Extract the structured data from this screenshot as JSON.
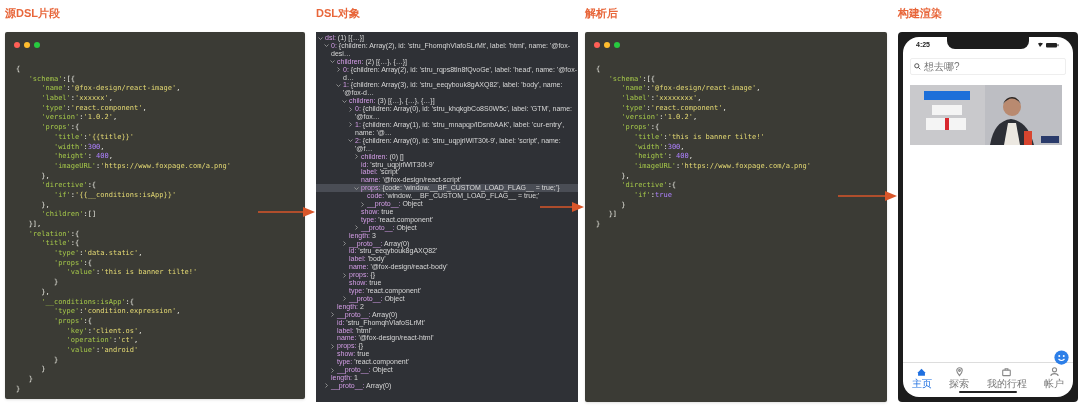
{
  "stages": [
    {
      "kind": "code",
      "title": "源DSL片段",
      "lines": [
        "{",
        "   'schema':[{",
        "      'name':'@fox-design/react-image',",
        "      'label':'xxxxxx',",
        "      'type':'react.component',",
        "      'version':'1.0.2',",
        "      'props':{",
        "         'title':'{{title}}'",
        "         'width':300,",
        "         'height': 400,",
        "         'imageURL':'https://www.foxpage.com/a.png'",
        "      },",
        "      'directive':{",
        "         'if':'{{__conditions:isApp}}'",
        "      },",
        "      'children':[]",
        "   }],",
        "   'relation':{",
        "      'title':{",
        "         'type':'data.static',",
        "         'props':{",
        "            'value':'this is banner tilte!'",
        "         }",
        "      },",
        "      '__conditions:isApp':{",
        "         'type':'condition.expression',",
        "         'props':{",
        "            'key':'client.os',",
        "            'operation':'ct',",
        "            'value':'android'",
        "         }",
        "      }",
        "   }",
        "}"
      ]
    },
    {
      "kind": "tree",
      "title": "DSL对象",
      "nodes": [
        {
          "text": "dsl: (1) [{…}]",
          "expanded": true,
          "selected": false,
          "children": [
            {
              "text": "0: {children: Array(2), id: 'stru_FhomqhVlafoSLrMt', label: 'html', name: '@fox-desi…",
              "expanded": true,
              "selected": false,
              "children": [
                {
                  "text": "children: (2) [{…}, {…}]",
                  "expanded": true,
                  "selected": false,
                  "children": [
                    {
                      "text": "0: {children: Array(2), id: 'stru_rqps8tln8fQvoGe', label: 'head', name: '@fox-d…",
                      "expanded": false,
                      "selected": false
                    },
                    {
                      "text": "1: {children: Array(3), id: 'stru_eeqybouk8gAXQ82', label: 'body', name: '@fox-d…",
                      "expanded": true,
                      "selected": false,
                      "children": [
                        {
                          "text": "children: (3) [{…}, {…}, {…}]",
                          "expanded": true,
                          "selected": false,
                          "children": [
                            {
                              "text": "0: {children: Array(0), id: 'stru_khqkgbCo8S0W5c', label: 'GTM', name: '@fox…",
                              "expanded": false,
                              "selected": false
                            },
                            {
                              "text": "1: {children: Array(1), id: 'stru_mnapqp/IDsnbAAK', label: 'cur-entry', name: '@…",
                              "expanded": false,
                              "selected": false
                            },
                            {
                              "text": "2: {children: Array(0), id: 'stru_uqpjriWlT30t-9', label: 'script', name: '@f…",
                              "expanded": true,
                              "selected": false,
                              "children": [
                                {
                                  "text": "children: (0) []",
                                  "expanded": false,
                                  "selected": false
                                },
                                {
                                  "text": "id: 'stru_uqpjriWlT30t-9'",
                                  "selected": false
                                },
                                {
                                  "text": "label: 'script'",
                                  "selected": false
                                },
                                {
                                  "text": "name: '@fox-design/react-script'",
                                  "selected": false
                                },
                                {
                                  "text": "props: {code: 'window.__BF_CUSTOM_LOAD_FLAG__ = true;'}",
                                  "expanded": true,
                                  "selected": true,
                                  "children": [
                                    {
                                      "text": "code: 'window.__BF_CUSTOM_LOAD_FLAG__ = true;'",
                                      "selected": false
                                    },
                                    {
                                      "text": "__proto__: Object",
                                      "expanded": false,
                                      "selected": false
                                    }
                                  ]
                                },
                                {
                                  "text": "show: true",
                                  "selected": false
                                },
                                {
                                  "text": "type: 'react.component'",
                                  "selected": false
                                },
                                {
                                  "text": "__proto__: Object",
                                  "expanded": false,
                                  "selected": false
                                }
                              ]
                            }
                          ]
                        },
                        {
                          "text": "length: 3",
                          "selected": false
                        },
                        {
                          "text": "__proto__: Array(0)",
                          "expanded": false,
                          "selected": false
                        },
                        {
                          "text": "id: 'stru_eeqybouk8gAXQ82'",
                          "selected": false
                        },
                        {
                          "text": "label: 'body'",
                          "selected": false
                        },
                        {
                          "text": "name: '@fox-design/react-body'",
                          "selected": false
                        },
                        {
                          "text": "props: {}",
                          "expanded": false,
                          "selected": false
                        },
                        {
                          "text": "show: true",
                          "selected": false
                        },
                        {
                          "text": "type: 'react.component'",
                          "selected": false
                        },
                        {
                          "text": "__proto__: Object",
                          "expanded": false,
                          "selected": false
                        }
                      ]
                    }
                  ]
                },
                {
                  "text": "length: 2",
                  "selected": false
                },
                {
                  "text": "__proto__: Array(0)",
                  "expanded": false,
                  "selected": false
                },
                {
                  "text": "id: 'stru_FhomqhVlafoSLrMt'",
                  "selected": false
                },
                {
                  "text": "label: 'html'",
                  "selected": false
                },
                {
                  "text": "name: '@fox-design/react-html'",
                  "selected": false
                },
                {
                  "text": "props: {}",
                  "expanded": false,
                  "selected": false
                },
                {
                  "text": "show: true",
                  "selected": false
                },
                {
                  "text": "type: 'react.component'",
                  "selected": false
                },
                {
                  "text": "__proto__: Object",
                  "expanded": false,
                  "selected": false
                }
              ]
            },
            {
              "text": "length: 1",
              "selected": false
            },
            {
              "text": "__proto__: Array(0)",
              "expanded": false,
              "selected": false
            }
          ]
        }
      ]
    },
    {
      "kind": "code",
      "title": "解析后",
      "lines": [
        "{",
        "   'schema':[{",
        "      'name':'@fox-design/react-image',",
        "      'label':'xxxxxxxx',",
        "      'type':'react.component',",
        "      'version':'1.0.2',",
        "      'props':{",
        "         'title':'this is banner tilte!'",
        "         'width':300,",
        "         'height': 400,",
        "         'imageURL':'https://www.foxpage.com/a.png'",
        "      },",
        "      'directive':{",
        "         'if':true",
        "      }",
        "   }]",
        "}"
      ]
    },
    {
      "kind": "phone",
      "title": "构建渲染",
      "time": "4:25",
      "search": {
        "placeholder": "想去哪?"
      },
      "tabs": [
        {
          "label": "主页",
          "selected": true
        },
        {
          "label": "探索",
          "selected": false
        },
        {
          "label": "我的行程",
          "selected": false
        },
        {
          "label": "帐户",
          "selected": false
        }
      ]
    }
  ]
}
